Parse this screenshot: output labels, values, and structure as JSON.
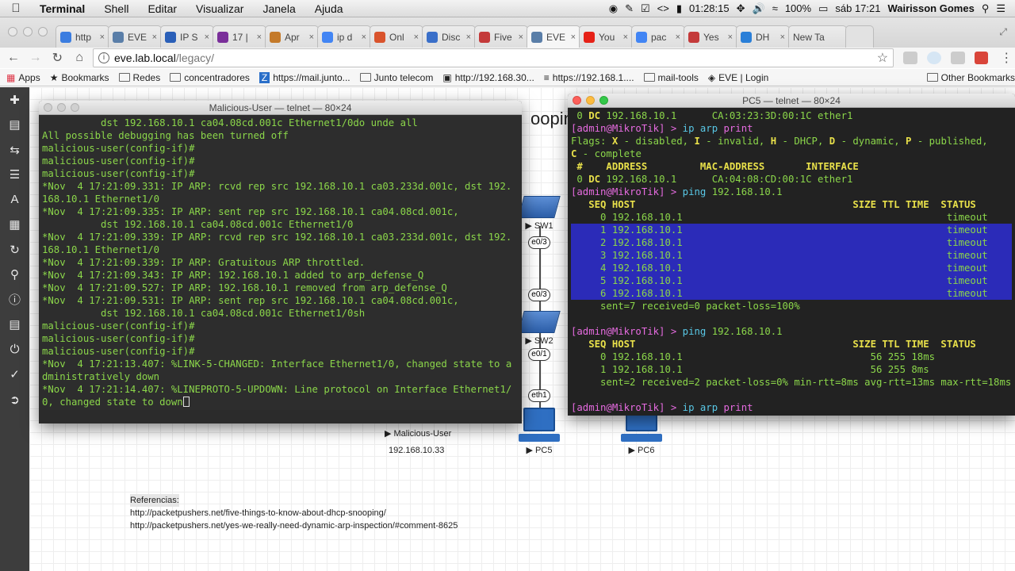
{
  "menubar": {
    "app": "Terminal",
    "menus": [
      "Shell",
      "Editar",
      "Visualizar",
      "Janela",
      "Ajuda"
    ],
    "time_remaining": "01:28:15",
    "battery": "100%",
    "clock": "sáb 17:21",
    "user": "Wairisson Gomes"
  },
  "tabs": [
    {
      "label": "http",
      "color": "#3b7de0"
    },
    {
      "label": "EVE",
      "color": "#5a7ea8"
    },
    {
      "label": "IP S",
      "color": "#2a5fb8"
    },
    {
      "label": "17 |",
      "color": "#7a2f9a"
    },
    {
      "label": "Apr",
      "color": "#c47a2a"
    },
    {
      "label": "ip d",
      "color": "#4285f4"
    },
    {
      "label": "Onl",
      "color": "#d9532c"
    },
    {
      "label": "Disc",
      "color": "#3a6fc9"
    },
    {
      "label": "Five",
      "color": "#c43a3a"
    },
    {
      "label": "EVE",
      "color": "#5a7ea8"
    },
    {
      "label": "You",
      "color": "#e62117"
    },
    {
      "label": "pac",
      "color": "#4285f4"
    },
    {
      "label": "Yes",
      "color": "#c43a3a"
    },
    {
      "label": "DH",
      "color": "#2a7fd8"
    }
  ],
  "new_tab_label": "New Ta",
  "address": {
    "host": "eve.lab.local",
    "path": "/legacy/"
  },
  "bookmarks": [
    {
      "label": "Apps",
      "icon": "apps-grid-icon"
    },
    {
      "label": "Bookmarks",
      "icon": "star-icon"
    },
    {
      "label": "Redes",
      "icon": "folder-icon"
    },
    {
      "label": "concentradores",
      "icon": "folder-icon"
    },
    {
      "label": "https://mail.junto...",
      "icon": "z-icon"
    },
    {
      "label": "Junto telecom",
      "icon": "folder-icon"
    },
    {
      "label": "http://192.168.30...",
      "icon": "cpu-icon"
    },
    {
      "label": "https://192.168.1....",
      "icon": "rss-icon"
    },
    {
      "label": "mail-tools",
      "icon": "folder-icon"
    },
    {
      "label": "EVE | Login",
      "icon": "eve-icon"
    }
  ],
  "other_bookmarks": "Other Bookmarks",
  "eve": {
    "title_fragment": "ooping / Dyna",
    "nodes": {
      "sw1": "SW1",
      "sw2": "SW2",
      "pc5": "PC5",
      "pc6": "PC6",
      "malicious": "Malicious-User",
      "malicious_ip": "192.168.10.33"
    },
    "interfaces": {
      "e03a": "e0/3",
      "e03b": "e0/3",
      "e01": "e0/1",
      "eth1": "eth1"
    },
    "refs": {
      "heading": "Referencias:",
      "line1": "http://packetpushers.net/five-things-to-know-about-dhcp-snooping/",
      "line2": "http://packetpushers.net/yes-we-really-need-dynamic-arp-inspection/#comment-8625"
    }
  },
  "term1": {
    "title": "Malicious-User — telnet — 80×24",
    "lines": [
      "          dst 192.168.10.1 ca04.08cd.001c Ethernet1/0do unde all",
      "All possible debugging has been turned off",
      "malicious-user(config-if)#",
      "malicious-user(config-if)#",
      "malicious-user(config-if)#",
      "*Nov  4 17:21:09.331: IP ARP: rcvd rep src 192.168.10.1 ca03.233d.001c, dst 192.",
      "168.10.1 Ethernet1/0",
      "*Nov  4 17:21:09.335: IP ARP: sent rep src 192.168.10.1 ca04.08cd.001c,",
      "          dst 192.168.10.1 ca04.08cd.001c Ethernet1/0",
      "*Nov  4 17:21:09.339: IP ARP: rcvd rep src 192.168.10.1 ca03.233d.001c, dst 192.",
      "168.10.1 Ethernet1/0",
      "*Nov  4 17:21:09.339: IP ARP: Gratuitous ARP throttled.",
      "*Nov  4 17:21:09.343: IP ARP: 192.168.10.1 added to arp_defense_Q",
      "*Nov  4 17:21:09.527: IP ARP: 192.168.10.1 removed from arp_defense_Q",
      "*Nov  4 17:21:09.531: IP ARP: sent rep src 192.168.10.1 ca04.08cd.001c,",
      "          dst 192.168.10.1 ca04.08cd.001c Ethernet1/0sh",
      "malicious-user(config-if)#",
      "malicious-user(config-if)#",
      "malicious-user(config-if)#",
      "*Nov  4 17:21:13.407: %LINK-5-CHANGED: Interface Ethernet1/0, changed state to a",
      "dministratively down",
      "*Nov  4 17:21:14.407: %LINEPROTO-5-UPDOWN: Line protocol on Interface Ethernet1/",
      "0, changed state to down"
    ]
  },
  "term2": {
    "title": "PC5 — telnet — 80×24",
    "line_dc1": {
      "idx": " 0 ",
      "flag": "DC",
      "addr": " 192.168.10.1      CA:03:23:3D:00:1C ether1"
    },
    "prompt_user": "[admin@MikroTik] > ",
    "cmd_ip": "ip arp",
    "cmd_print": "print",
    "cmd_ping": "ping",
    "ping_target": " 192.168.10.1",
    "flags_label": "Flags: ",
    "flags": [
      {
        "k": "X",
        "v": " - disabled, "
      },
      {
        "k": "I",
        "v": " - invalid, "
      },
      {
        "k": "H",
        "v": " - DHCP, "
      },
      {
        "k": "D",
        "v": " - dynamic, "
      },
      {
        "k": "P",
        "v": " - published,"
      }
    ],
    "flags_c": {
      "k": "C",
      "v": " - complete"
    },
    "arp_header": " #    ADDRESS         MAC-ADDRESS       INTERFACE",
    "line_dc0": {
      "idx": " 0 ",
      "flag": "DC",
      "addr": " 192.168.10.1      CA:04:08:CD:00:1C ether1"
    },
    "ping_header": "   SEQ HOST                                     SIZE TTL TIME  STATUS",
    "ping1_rows": [
      "     0 192.168.10.1                                             timeout",
      "     1 192.168.10.1                                             timeout",
      "     2 192.168.10.1                                             timeout",
      "     3 192.168.10.1                                             timeout",
      "     4 192.168.10.1                                             timeout",
      "     5 192.168.10.1                                             timeout",
      "     6 192.168.10.1                                             timeout"
    ],
    "ping1_summary": "     sent=7 received=0 packet-loss=100%",
    "ping2_rows": [
      "     0 192.168.10.1                                56 255 18ms",
      "     1 192.168.10.1                                56 255 8ms"
    ],
    "ping2_summary": "     sent=2 received=2 packet-loss=0% min-rtt=8ms avg-rtt=13ms max-rtt=18ms"
  }
}
